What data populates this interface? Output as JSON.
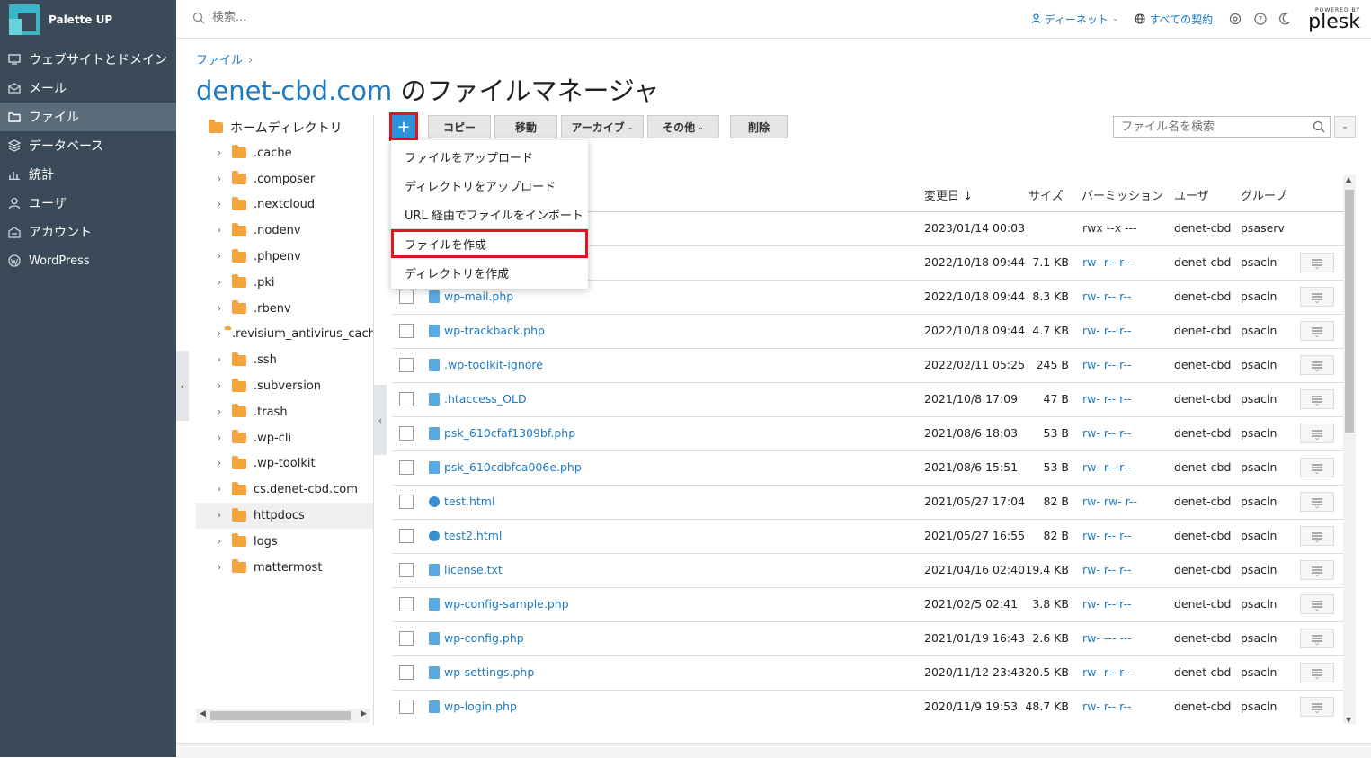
{
  "brand": {
    "name": "Palette UP"
  },
  "sidebar": {
    "items": [
      {
        "label": "ウェブサイトとドメイン",
        "icon": "monitor-icon"
      },
      {
        "label": "メール",
        "icon": "mail-icon"
      },
      {
        "label": "ファイル",
        "icon": "folder-icon",
        "active": true
      },
      {
        "label": "データベース",
        "icon": "database-icon"
      },
      {
        "label": "統計",
        "icon": "chart-icon"
      },
      {
        "label": "ユーザ",
        "icon": "user-icon"
      },
      {
        "label": "アカウント",
        "icon": "account-icon"
      },
      {
        "label": "WordPress",
        "icon": "wordpress-icon"
      }
    ]
  },
  "topbar": {
    "search_placeholder": "検索...",
    "user_label": "ディーネット",
    "subscriptions_label": "すべての契約",
    "powered_by": "POWERED BY",
    "plesk": "plesk"
  },
  "breadcrumb": {
    "item": "ファイル",
    "sep": "›"
  },
  "title": {
    "domain": "denet-cbd.com",
    "suffix": " のファイルマネージャ"
  },
  "tree": {
    "root": "ホームディレクトリ",
    "items": [
      ".cache",
      ".composer",
      ".nextcloud",
      ".nodenv",
      ".phpenv",
      ".pki",
      ".rbenv",
      ".revisium_antivirus_cach",
      ".ssh",
      ".subversion",
      ".trash",
      ".wp-cli",
      ".wp-toolkit",
      "cs.denet-cbd.com",
      "httpdocs",
      "logs",
      "mattermost"
    ]
  },
  "toolbar": {
    "add_label": "+",
    "copy": "コピー",
    "move": "移動",
    "archive": "アーカイブ",
    "other": "その他",
    "delete": "削除",
    "search_placeholder": "ファイル名を検索"
  },
  "dropdown": {
    "upload_file": "ファイルをアップロード",
    "upload_dir": "ディレクトリをアップロード",
    "import_url": "URL 経由でファイルをインポート",
    "create_file": "ファイルを作成",
    "create_dir": "ディレクトリを作成"
  },
  "table": {
    "headers": {
      "modified": "変更日 ↓",
      "size": "サイズ",
      "perm": "パーミッション",
      "user": "ユーザ",
      "group": "グループ"
    },
    "rows": [
      {
        "name": "",
        "date": "2023/01/14 00:03",
        "size": "",
        "perm": "rwx --x ---",
        "user": "denet-cbd",
        "group": "psaserv",
        "kind": "dir"
      },
      {
        "name": "",
        "date": "2022/10/18 09:44",
        "size": "7.1 KB",
        "perm": "rw- r-- r--",
        "user": "denet-cbd",
        "group": "psacln",
        "kind": "file"
      },
      {
        "name": "wp-mail.php",
        "date": "2022/10/18 09:44",
        "size": "8.3 KB",
        "perm": "rw- r-- r--",
        "user": "denet-cbd",
        "group": "psacln",
        "kind": "file"
      },
      {
        "name": "wp-trackback.php",
        "date": "2022/10/18 09:44",
        "size": "4.7 KB",
        "perm": "rw- r-- r--",
        "user": "denet-cbd",
        "group": "psacln",
        "kind": "file"
      },
      {
        "name": ".wp-toolkit-ignore",
        "date": "2022/02/11 05:25",
        "size": "245 B",
        "perm": "rw- r-- r--",
        "user": "denet-cbd",
        "group": "psacln",
        "kind": "file"
      },
      {
        "name": ".htaccess_OLD",
        "date": "2021/10/8 17:09",
        "size": "47 B",
        "perm": "rw- r-- r--",
        "user": "denet-cbd",
        "group": "psacln",
        "kind": "file"
      },
      {
        "name": "psk_610cfaf1309bf.php",
        "date": "2021/08/6 18:03",
        "size": "53 B",
        "perm": "rw- r-- r--",
        "user": "denet-cbd",
        "group": "psacln",
        "kind": "file"
      },
      {
        "name": "psk_610cdbfca006e.php",
        "date": "2021/08/6 15:51",
        "size": "53 B",
        "perm": "rw- r-- r--",
        "user": "denet-cbd",
        "group": "psacln",
        "kind": "file"
      },
      {
        "name": "test.html",
        "date": "2021/05/27 17:04",
        "size": "82 B",
        "perm": "rw- rw- r--",
        "user": "denet-cbd",
        "group": "psacln",
        "kind": "web"
      },
      {
        "name": "test2.html",
        "date": "2021/05/27 16:55",
        "size": "82 B",
        "perm": "rw- r-- r--",
        "user": "denet-cbd",
        "group": "psacln",
        "kind": "web"
      },
      {
        "name": "license.txt",
        "date": "2021/04/16 02:40",
        "size": "19.4 KB",
        "perm": "rw- r-- r--",
        "user": "denet-cbd",
        "group": "psacln",
        "kind": "file"
      },
      {
        "name": "wp-config-sample.php",
        "date": "2021/02/5 02:41",
        "size": "3.8 KB",
        "perm": "rw- r-- r--",
        "user": "denet-cbd",
        "group": "psacln",
        "kind": "file"
      },
      {
        "name": "wp-config.php",
        "date": "2021/01/19 16:43",
        "size": "2.6 KB",
        "perm": "rw- --- ---",
        "user": "denet-cbd",
        "group": "psacln",
        "kind": "file"
      },
      {
        "name": "wp-settings.php",
        "date": "2020/11/12 23:43",
        "size": "20.5 KB",
        "perm": "rw- r-- r--",
        "user": "denet-cbd",
        "group": "psacln",
        "kind": "file"
      },
      {
        "name": "wp-login.php",
        "date": "2020/11/9 19:53",
        "size": "48.7 KB",
        "perm": "rw- r-- r--",
        "user": "denet-cbd",
        "group": "psacln",
        "kind": "file"
      }
    ]
  },
  "colors": {
    "sidebar": "#3a4a58",
    "accent": "#1e7ac2",
    "highlight": "#e0151d",
    "add_button": "#2c93d8"
  }
}
